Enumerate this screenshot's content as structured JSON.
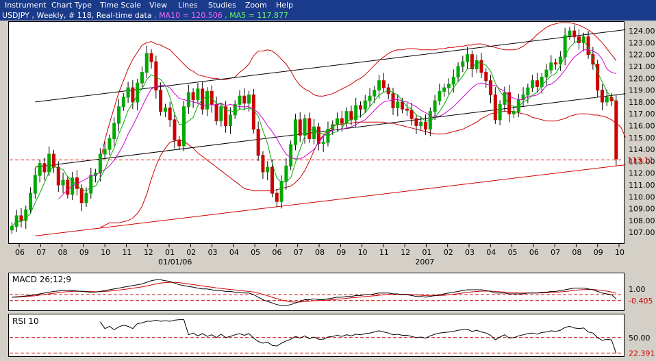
{
  "menu": [
    "Instrument",
    "Chart Type",
    "Time Scale",
    "View",
    "Lines",
    "Studies",
    "Zoom",
    "Help"
  ],
  "info": {
    "symbol": "USDJPY , Weekly, # 118, Real-time data",
    "ma10": "MA10 = 120.506",
    "ma5": "MA5 = 117.877",
    "sep": " , "
  },
  "colors": {
    "ma10": "#cc00cc",
    "ma5": "#00aa00",
    "up": "#00aa00",
    "down": "#cc0000",
    "bb": "#cc0000"
  },
  "chart_data": {
    "type": "candlestick",
    "y_ticks": [
      "124.00",
      "123.00",
      "122.00",
      "121.00",
      "120.00",
      "119.00",
      "118.00",
      "117.00",
      "116.00",
      "115.00",
      "114.00",
      "113.00",
      "112.00",
      "111.00",
      "110.00",
      "109.00",
      "108.00",
      "107.00"
    ],
    "ylim": [
      106.2,
      124.7
    ],
    "current_price": "113.11",
    "current_value": 113.11,
    "x_ticks": [
      "06",
      "07",
      "08",
      "09",
      "10",
      "11",
      "12",
      "01",
      "02",
      "03",
      "04",
      "05",
      "06",
      "07",
      "08",
      "09",
      "10",
      "11",
      "12",
      "01",
      "02",
      "03",
      "04",
      "05",
      "06",
      "07",
      "08",
      "09",
      "10"
    ],
    "date_labels": [
      {
        "label": "01/01/06",
        "tick": 7
      },
      {
        "label": "2007",
        "tick": 19
      }
    ],
    "closes": [
      107.5,
      108.4,
      108.0,
      108.9,
      110.3,
      111.8,
      112.8,
      112.1,
      113.6,
      112.5,
      111.0,
      111.4,
      110.2,
      111.6,
      110.7,
      109.5,
      110.3,
      111.8,
      112.0,
      113.6,
      114.0,
      114.9,
      116.2,
      117.6,
      118.4,
      119.2,
      118.0,
      119.6,
      120.5,
      122.1,
      121.4,
      119.0,
      117.2,
      117.5,
      116.5,
      114.8,
      114.3,
      117.6,
      118.8,
      118.2,
      119.1,
      117.4,
      118.9,
      117.8,
      116.4,
      117.6,
      116.0,
      116.9,
      117.8,
      118.5,
      117.9,
      118.6,
      115.7,
      113.5,
      112.1,
      112.5,
      110.3,
      109.6,
      111.3,
      112.6,
      114.4,
      116.5,
      115.2,
      116.6,
      114.9,
      115.9,
      114.5,
      114.6,
      115.7,
      116.1,
      116.6,
      116.2,
      117.2,
      116.5,
      117.7,
      117.4,
      118.1,
      118.5,
      119.0,
      119.8,
      119.2,
      118.7,
      117.5,
      118.0,
      117.4,
      117.3,
      116.6,
      116.0,
      116.3,
      115.7,
      117.2,
      118.1,
      118.9,
      119.2,
      119.5,
      120.1,
      121.0,
      121.4,
      122.0,
      120.8,
      121.5,
      120.5,
      119.8,
      118.6,
      116.5,
      117.8,
      118.8,
      117.0,
      117.2,
      118.2,
      118.6,
      119.2,
      119.8,
      119.3,
      120.1,
      120.7,
      121.3,
      121.2,
      121.8,
      123.6,
      124.0,
      123.5,
      123.0,
      123.5,
      122.0,
      121.2,
      119.0,
      118.0,
      118.4,
      118.1,
      113.2
    ],
    "ma5": [
      107.5,
      107.9,
      107.9,
      108.2,
      108.6,
      109.5,
      110.3,
      111.2,
      112.1,
      112.6,
      112.4,
      112.3,
      111.7,
      111.3,
      111.0,
      110.6,
      110.5,
      110.8,
      110.9,
      111.6,
      112.3,
      113.3,
      114.1,
      115.3,
      116.2,
      117.3,
      117.9,
      118.6,
      119.1,
      119.9,
      120.3,
      120.1,
      119.9,
      119.4,
      118.4,
      117.0,
      116.1,
      116.1,
      116.4,
      116.7,
      117.7,
      118.2,
      118.5,
      118.3,
      117.9,
      117.9,
      117.3,
      117.3,
      117.1,
      117.4,
      117.4,
      117.5,
      117.3,
      116.8,
      115.6,
      114.5,
      112.8,
      111.6,
      111.2,
      111.3,
      111.6,
      112.9,
      114.0,
      115.1,
      115.5,
      115.8,
      115.4,
      115.3,
      115.1,
      115.4,
      115.5,
      115.8,
      116.4,
      116.5,
      116.8,
      116.8,
      117.1,
      117.6,
      118.1,
      118.6,
      118.8,
      119.0,
      118.8,
      118.6,
      118.1,
      117.6,
      117.4,
      116.9,
      116.7,
      116.4,
      116.4,
      116.7,
      117.2,
      117.8,
      118.6,
      119.2,
      119.7,
      120.2,
      120.8,
      120.9,
      121.3,
      121.3,
      121.1,
      120.6,
      119.6,
      118.9,
      118.4,
      117.8,
      117.6,
      117.6,
      118.0,
      118.2,
      118.6,
      118.8,
      119.4,
      119.8,
      120.2,
      120.4,
      121.1,
      121.9,
      122.6,
      123.0,
      123.2,
      123.2,
      122.6,
      121.7,
      120.5,
      119.7,
      118.9,
      118.4,
      117.9
    ],
    "ma10": [
      null,
      null,
      null,
      null,
      null,
      null,
      null,
      null,
      null,
      null,
      109.8,
      110.2,
      110.6,
      110.9,
      111.1,
      111.3,
      111.5,
      111.8,
      111.8,
      112.1,
      112.3,
      112.6,
      113.1,
      113.7,
      114.4,
      115.3,
      116.0,
      116.8,
      117.6,
      118.4,
      119.1,
      119.3,
      119.4,
      119.4,
      119.2,
      118.7,
      118.3,
      118.2,
      118.1,
      118.0,
      117.9,
      117.7,
      117.7,
      117.8,
      117.7,
      117.9,
      117.7,
      117.8,
      117.7,
      117.6,
      117.6,
      117.6,
      117.4,
      117.1,
      116.6,
      116.0,
      115.5,
      114.9,
      114.2,
      113.6,
      113.3,
      113.2,
      113.2,
      113.4,
      113.7,
      114.0,
      114.6,
      115.1,
      115.4,
      115.6,
      115.7,
      115.7,
      115.8,
      115.9,
      116.1,
      116.3,
      116.5,
      116.9,
      117.3,
      117.7,
      118.0,
      118.1,
      118.2,
      118.2,
      118.1,
      118.0,
      117.8,
      117.6,
      117.3,
      117.1,
      116.8,
      116.8,
      116.8,
      117.0,
      117.3,
      117.6,
      118.0,
      118.4,
      118.8,
      119.2,
      119.5,
      119.6,
      119.5,
      119.4,
      119.4,
      119.1,
      118.9,
      118.5,
      118.3,
      118.2,
      118.2,
      118.5,
      118.5,
      118.6,
      118.9,
      119.4,
      119.5,
      119.8,
      120.2,
      120.7,
      121.3,
      121.8,
      122.1,
      122.4,
      122.4,
      122.3,
      122.1,
      121.6,
      120.8,
      120.5,
      120.4
    ],
    "bb_upper": [
      null,
      null,
      null,
      null,
      null,
      null,
      null,
      null,
      null,
      null,
      null,
      null,
      null,
      null,
      null,
      null,
      null,
      null,
      null,
      113.0,
      114.8,
      116.2,
      117.5,
      118.8,
      119.8,
      120.8,
      121.6,
      122.2,
      122.8,
      123.0,
      123.1,
      122.9,
      122.8,
      122.6,
      122.4,
      122.0,
      121.6,
      121.2,
      120.8,
      120.6,
      120.3,
      120.2,
      120.1,
      120.0,
      120.0,
      119.9,
      119.9,
      120.0,
      120.1,
      120.5,
      120.8,
      121.2,
      121.9,
      122.3,
      122.3,
      122.4,
      122.3,
      122.0,
      121.6,
      121.2,
      120.6,
      119.9,
      119.4,
      119.1,
      118.9,
      118.6,
      118.5,
      118.5,
      118.6,
      118.7,
      118.9,
      119.1,
      119.3,
      119.5,
      119.8,
      120.0,
      120.3,
      120.7,
      121.1,
      121.5,
      121.8,
      122.1,
      122.3,
      122.4,
      122.4,
      122.5,
      122.5,
      122.5,
      122.4,
      122.4,
      122.4,
      122.4,
      122.5,
      122.5,
      122.6,
      122.6,
      122.7,
      122.7,
      122.8,
      122.8,
      122.9,
      122.9,
      122.8,
      122.7,
      122.6,
      122.5,
      122.4,
      122.4,
      122.4,
      122.5,
      122.7,
      123.0,
      123.3,
      123.7,
      124.0,
      124.3,
      124.5,
      124.6,
      124.7,
      124.7,
      124.7,
      124.6,
      124.5,
      124.3,
      124.1,
      123.8,
      123.4,
      123.0,
      122.5,
      122.0,
      121.5
    ],
    "bb_lower": [
      null,
      null,
      null,
      null,
      null,
      null,
      null,
      null,
      null,
      null,
      null,
      null,
      null,
      null,
      null,
      null,
      null,
      null,
      null,
      107.4,
      107.6,
      107.8,
      107.8,
      107.8,
      107.9,
      108.0,
      108.2,
      108.6,
      109.2,
      110.2,
      111.5,
      112.6,
      113.5,
      114.1,
      114.6,
      114.7,
      114.8,
      114.7,
      114.4,
      114.1,
      113.7,
      113.4,
      113.1,
      112.8,
      112.5,
      112.2,
      111.9,
      111.6,
      111.3,
      111.0,
      110.7,
      110.6,
      110.5,
      110.5,
      110.5,
      110.5,
      110.5,
      110.6,
      110.7,
      110.8,
      110.9,
      111.2,
      111.6,
      112.2,
      113.0,
      113.9,
      114.7,
      115.2,
      115.6,
      115.9,
      116.1,
      116.1,
      116.2,
      116.2,
      116.3,
      116.3,
      116.3,
      116.3,
      116.3,
      116.3,
      116.3,
      116.2,
      116.2,
      116.1,
      116.0,
      115.9,
      115.8,
      115.7,
      115.6,
      115.5,
      115.4,
      115.3,
      115.3,
      115.3,
      115.4,
      115.5,
      115.6,
      115.7,
      115.9,
      116.1,
      116.3,
      116.6,
      116.8,
      117.0,
      117.1,
      117.2,
      117.2,
      117.2,
      117.2,
      117.1,
      117.0,
      116.9,
      116.7,
      116.6,
      116.5,
      116.4,
      116.4,
      116.4,
      116.5,
      116.6,
      116.8,
      116.9,
      117.0,
      117.0,
      117.0,
      116.9,
      116.9,
      116.8,
      116.7,
      116.5,
      116.2,
      115.9,
      115.0
    ],
    "trendlines": [
      {
        "name": "channel-top",
        "color": "#000000",
        "from": [
          5,
          118.0
        ],
        "to": [
          132,
          124.1
        ]
      },
      {
        "name": "channel-mid",
        "color": "#000000",
        "from": [
          5,
          112.5
        ],
        "to": [
          132,
          118.7
        ]
      },
      {
        "name": "channel-low",
        "color": "#cc0000",
        "from": [
          5,
          106.7
        ],
        "to": [
          132,
          112.7
        ]
      }
    ],
    "macd": {
      "title": "MACD 26;12;9",
      "ticks": [
        "1.00",
        "-0.405"
      ],
      "tick_values": [
        1.0,
        -0.405
      ],
      "levels": [
        0.3,
        -0.405
      ],
      "ylim": [
        -1.5,
        2.8
      ],
      "macd_line": [
        0.0,
        0.05,
        0.1,
        0.15,
        0.2,
        0.3,
        0.4,
        0.5,
        0.6,
        0.7,
        0.75,
        0.8,
        0.8,
        0.78,
        0.75,
        0.7,
        0.65,
        0.6,
        0.62,
        0.7,
        0.8,
        0.9,
        1.0,
        1.1,
        1.2,
        1.3,
        1.4,
        1.5,
        1.6,
        1.8,
        2.0,
        2.1,
        2.1,
        2.0,
        1.9,
        1.7,
        1.5,
        1.4,
        1.3,
        1.2,
        1.1,
        1.0,
        1.0,
        0.9,
        0.8,
        0.8,
        0.7,
        0.7,
        0.6,
        0.6,
        0.5,
        0.5,
        0.3,
        0.0,
        -0.3,
        -0.5,
        -0.7,
        -0.9,
        -1.0,
        -1.0,
        -0.9,
        -0.7,
        -0.5,
        -0.3,
        -0.3,
        -0.2,
        -0.3,
        -0.3,
        -0.2,
        -0.1,
        0.0,
        0.0,
        0.1,
        0.1,
        0.2,
        0.2,
        0.3,
        0.3,
        0.4,
        0.5,
        0.5,
        0.5,
        0.4,
        0.4,
        0.3,
        0.3,
        0.2,
        0.1,
        0.1,
        0.0,
        0.1,
        0.2,
        0.3,
        0.4,
        0.5,
        0.6,
        0.7,
        0.8,
        0.9,
        0.9,
        0.9,
        0.9,
        0.8,
        0.7,
        0.5,
        0.5,
        0.5,
        0.4,
        0.4,
        0.4,
        0.4,
        0.5,
        0.5,
        0.5,
        0.6,
        0.6,
        0.7,
        0.7,
        0.8,
        0.9,
        1.0,
        1.1,
        1.1,
        1.1,
        1.0,
        0.9,
        0.7,
        0.5,
        0.4,
        0.3,
        -0.2
      ],
      "signal_line": [
        0.0,
        0.0,
        0.05,
        0.08,
        0.12,
        0.18,
        0.25,
        0.32,
        0.4,
        0.48,
        0.55,
        0.62,
        0.66,
        0.7,
        0.72,
        0.72,
        0.7,
        0.68,
        0.66,
        0.67,
        0.7,
        0.74,
        0.8,
        0.86,
        0.93,
        1.0,
        1.08,
        1.16,
        1.25,
        1.36,
        1.48,
        1.6,
        1.7,
        1.76,
        1.79,
        1.78,
        1.74,
        1.68,
        1.6,
        1.52,
        1.44,
        1.35,
        1.28,
        1.2,
        1.12,
        1.06,
        0.99,
        0.93,
        0.87,
        0.81,
        0.75,
        0.7,
        0.62,
        0.5,
        0.34,
        0.17,
        0.0,
        -0.18,
        -0.34,
        -0.47,
        -0.56,
        -0.6,
        -0.58,
        -0.53,
        -0.48,
        -0.42,
        -0.4,
        -0.38,
        -0.34,
        -0.3,
        -0.24,
        -0.19,
        -0.13,
        -0.08,
        -0.02,
        0.02,
        0.08,
        0.12,
        0.18,
        0.24,
        0.29,
        0.33,
        0.35,
        0.36,
        0.35,
        0.34,
        0.31,
        0.27,
        0.24,
        0.19,
        0.17,
        0.17,
        0.2,
        0.24,
        0.29,
        0.35,
        0.42,
        0.5,
        0.58,
        0.64,
        0.69,
        0.73,
        0.74,
        0.73,
        0.69,
        0.65,
        0.62,
        0.58,
        0.55,
        0.52,
        0.5,
        0.5,
        0.5,
        0.5,
        0.52,
        0.54,
        0.57,
        0.6,
        0.64,
        0.69,
        0.75,
        0.82,
        0.88,
        0.92,
        0.94,
        0.93,
        0.88,
        0.81,
        0.73,
        0.64,
        0.47
      ]
    },
    "rsi": {
      "title": "RSI 10",
      "ticks": [
        "50.00",
        "22.391"
      ],
      "tick_values": [
        50.0,
        22.391
      ],
      "levels": [
        50.0,
        22.391
      ],
      "ylim": [
        18,
        90
      ],
      "values": [
        null,
        null,
        null,
        null,
        null,
        null,
        null,
        null,
        null,
        null,
        null,
        null,
        null,
        null,
        null,
        null,
        null,
        null,
        null,
        78,
        66,
        70,
        64,
        69,
        72,
        70,
        66,
        75,
        76,
        79,
        79,
        81,
        79,
        80,
        79,
        81,
        82,
        82,
        55,
        58,
        53,
        57,
        52,
        55,
        50,
        56,
        50,
        52,
        55,
        57,
        54,
        57,
        49,
        43,
        40,
        42,
        36,
        35,
        40,
        44,
        47,
        52,
        49,
        53,
        48,
        51,
        47,
        47,
        51,
        52,
        54,
        52,
        55,
        53,
        56,
        55,
        57,
        58,
        60,
        62,
        60,
        58,
        55,
        56,
        54,
        54,
        52,
        50,
        51,
        49,
        53,
        56,
        58,
        59,
        60,
        61,
        63,
        64,
        65,
        61,
        63,
        60,
        58,
        54,
        46,
        51,
        55,
        49,
        50,
        53,
        55,
        57,
        58,
        56,
        59,
        60,
        62,
        61,
        63,
        68,
        70,
        67,
        66,
        67,
        60,
        58,
        50,
        45,
        47,
        46,
        22
      ]
    }
  }
}
